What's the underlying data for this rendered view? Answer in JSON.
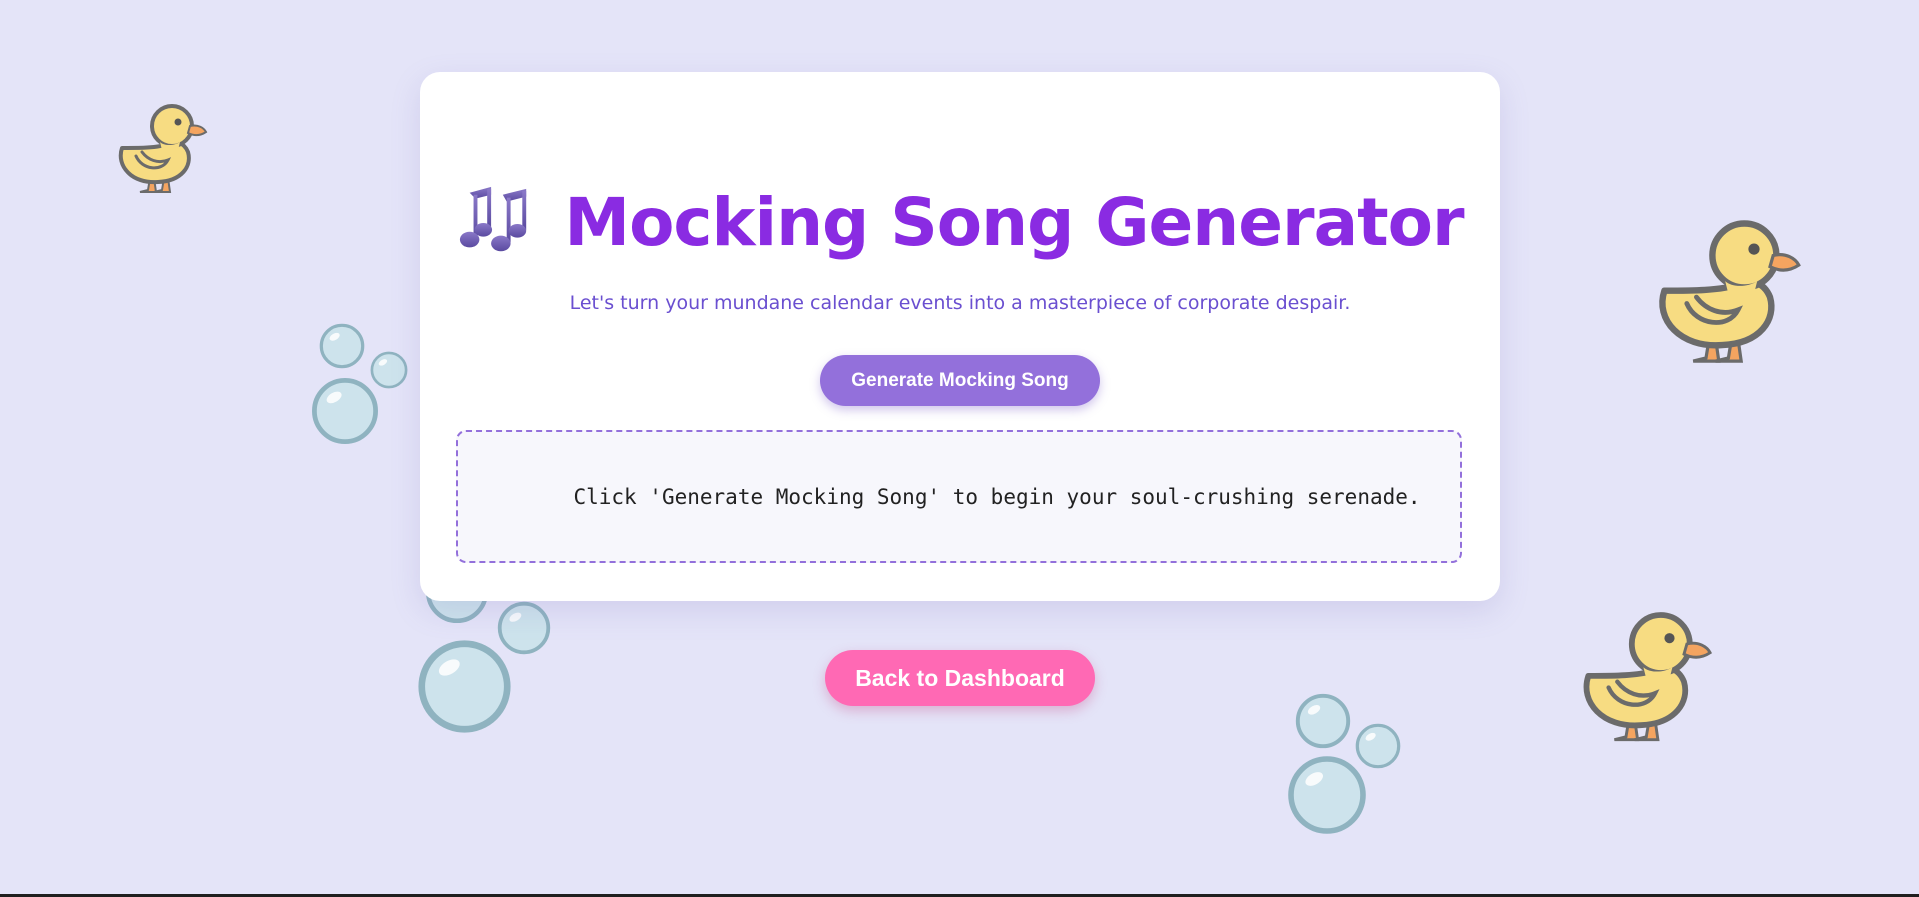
{
  "header": {
    "title": "Mocking Song Generator",
    "title_icon": "musical-notes-icon",
    "subtitle": "Let's turn your mundane calendar events into a masterpiece of corporate despair."
  },
  "actions": {
    "generate_label": "Generate Mocking Song",
    "back_label": "Back to Dashboard"
  },
  "output": {
    "placeholder_text": "Click 'Generate Mocking Song' to begin your soul-crushing serenade."
  },
  "decorations": {
    "ducks": [
      "duck-icon",
      "duck-icon",
      "duck-icon"
    ],
    "bubbles": [
      "bubbles-icon",
      "bubbles-icon",
      "bubbles-icon"
    ]
  },
  "colors": {
    "background": "#e4e4f8",
    "title": "#8a2be2",
    "subtitle": "#6a4fd0",
    "generate_button": "#9370db",
    "back_button": "#ff69b4",
    "card": "#ffffff"
  }
}
